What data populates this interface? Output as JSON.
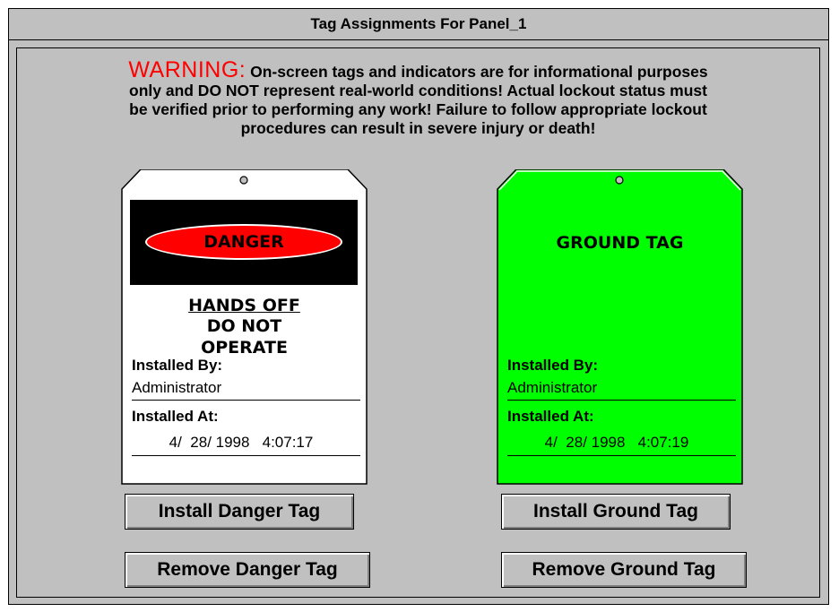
{
  "window": {
    "title": "Tag Assignments For Panel_1"
  },
  "warning": {
    "label": "WARNING:",
    "line1": "On-screen tags and indicators are for informational purposes",
    "line2": "only and DO NOT represent real-world conditions!  Actual lockout status must",
    "line3": "be verified prior to performing any work!  Failure to follow appropriate lockout",
    "line4": "procedures can result in severe injury or death!"
  },
  "danger_tag": {
    "header": "DANGER",
    "line1": "HANDS OFF",
    "line2": "DO NOT",
    "line3": "OPERATE",
    "installed_by_label": "Installed By:",
    "installed_by_value": "Administrator",
    "installed_at_label": "Installed At:",
    "installed_at_value": "4/  28/ 1998   4:07:17",
    "color": "#ffffff",
    "accent": "#ff0000"
  },
  "ground_tag": {
    "header": "GROUND TAG",
    "installed_by_label": "Installed By:",
    "installed_by_value": "Administrator",
    "installed_at_label": "Installed At:",
    "installed_at_value": "4/  28/ 1998   4:07:19",
    "color": "#00ff00"
  },
  "buttons": {
    "install_danger": "Install Danger Tag",
    "remove_danger": "Remove Danger Tag",
    "install_ground": "Install Ground Tag",
    "remove_ground": "Remove Ground Tag"
  }
}
